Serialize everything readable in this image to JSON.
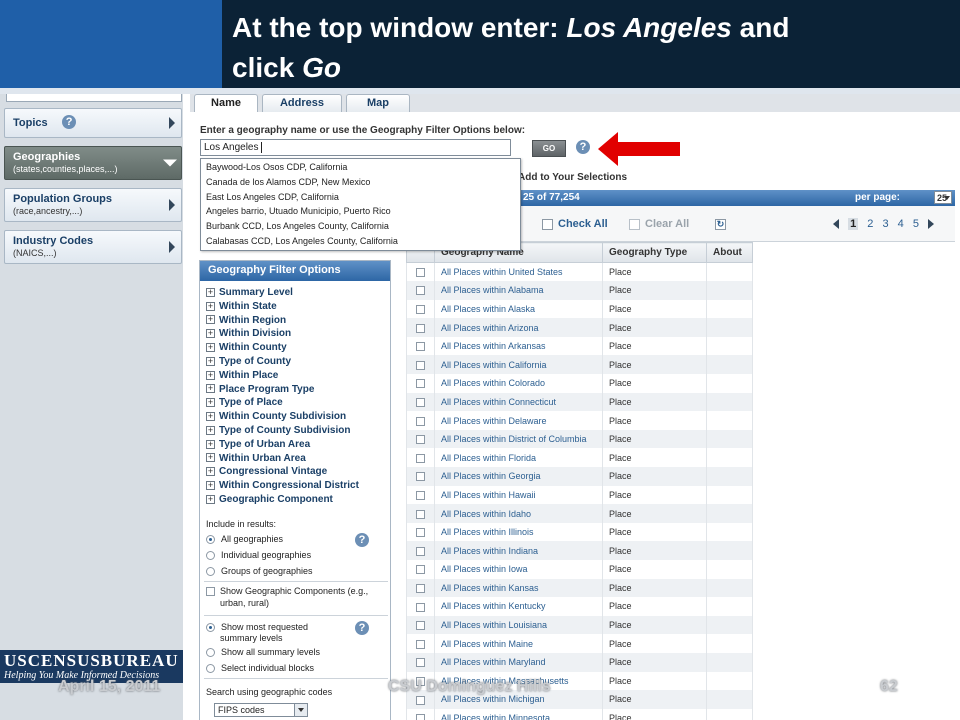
{
  "slide": {
    "title_line1_prefix": "At the top window enter: ",
    "title_line1_italic": "Los Angeles",
    "title_line1_suffix": " and",
    "title_line2_prefix": "click ",
    "title_line2_italic": "Go",
    "colors": {
      "title_bg": "#0b2236",
      "corner_blue": "#1f5fa8",
      "arrow": "#e10000"
    }
  },
  "sidebar": {
    "panels": [
      {
        "title": "Topics",
        "sub": "",
        "active": false,
        "help": "?"
      },
      {
        "title": "Geographies",
        "sub": "(states,counties,places,...)",
        "active": true
      },
      {
        "title": "Population Groups",
        "sub": "(race,ancestry,...)",
        "active": false
      },
      {
        "title": "Industry Codes",
        "sub": "(NAICS,...)",
        "active": false
      }
    ],
    "logo_line1": "USCENSUSBUREAU",
    "logo_line2": "Helping You Make Informed Decisions"
  },
  "tabs": [
    "Name",
    "Address",
    "Map"
  ],
  "search": {
    "label": "Enter a geography name or use the Geography Filter Options below:",
    "value": "Los Angeles",
    "go_label": "GO",
    "help": "?",
    "add_label": "Add to Your Selections",
    "suggestions": [
      "Baywood-Los Osos CDP, California",
      "Canada de los Alamos CDP, New Mexico",
      "East Los Angeles CDP, California",
      "Angeles barrio, Utuado Municipio, Puerto Rico",
      "Burbank CCD, Los Angeles County, California",
      "Calabasas CCD, Los Angeles County, California"
    ]
  },
  "results": {
    "count_text": "25  of  77,254",
    "per_page_label": "per page:",
    "per_page_value": "25",
    "check_all": "Check All",
    "clear_all": "Clear All",
    "pages": [
      "1",
      "2",
      "3",
      "4",
      "5"
    ],
    "columns": [
      "Geography Name",
      "Geography Type",
      "About"
    ],
    "rows": [
      {
        "name": "All Places within United States",
        "type": "Place"
      },
      {
        "name": "All Places within Alabama",
        "type": "Place"
      },
      {
        "name": "All Places within Alaska",
        "type": "Place"
      },
      {
        "name": "All Places within Arizona",
        "type": "Place"
      },
      {
        "name": "All Places within Arkansas",
        "type": "Place"
      },
      {
        "name": "All Places within California",
        "type": "Place"
      },
      {
        "name": "All Places within Colorado",
        "type": "Place"
      },
      {
        "name": "All Places within Connecticut",
        "type": "Place"
      },
      {
        "name": "All Places within Delaware",
        "type": "Place"
      },
      {
        "name": "All Places within District of Columbia",
        "type": "Place"
      },
      {
        "name": "All Places within Florida",
        "type": "Place"
      },
      {
        "name": "All Places within Georgia",
        "type": "Place"
      },
      {
        "name": "All Places within Hawaii",
        "type": "Place"
      },
      {
        "name": "All Places within Idaho",
        "type": "Place"
      },
      {
        "name": "All Places within Illinois",
        "type": "Place"
      },
      {
        "name": "All Places within Indiana",
        "type": "Place"
      },
      {
        "name": "All Places within Iowa",
        "type": "Place"
      },
      {
        "name": "All Places within Kansas",
        "type": "Place"
      },
      {
        "name": "All Places within Kentucky",
        "type": "Place"
      },
      {
        "name": "All Places within Louisiana",
        "type": "Place"
      },
      {
        "name": "All Places within Maine",
        "type": "Place"
      },
      {
        "name": "All Places within Maryland",
        "type": "Place"
      },
      {
        "name": "All Places within Massachusetts",
        "type": "Place"
      },
      {
        "name": "All Places within Michigan",
        "type": "Place"
      },
      {
        "name": "All Places within Minnesota",
        "type": "Place"
      }
    ]
  },
  "filter": {
    "title": "Geography Filter Options",
    "items": [
      "Summary Level",
      "Within State",
      "Within Region",
      "Within Division",
      "Within County",
      "Type of County",
      "Within Place",
      "Place Program Type",
      "Type of Place",
      "Within County Subdivision",
      "Type of County Subdivision",
      "Type of Urban Area",
      "Within Urban Area",
      "Congressional Vintage",
      "Within Congressional District",
      "Geographic Component"
    ],
    "include_label": "Include in results:",
    "include_options": [
      "All geographies",
      "Individual geographies",
      "Groups of geographies"
    ],
    "show_components_l1": "Show Geographic Components (e.g.,",
    "show_components_l2": "urban, rural)",
    "summary_options": [
      "Show most requested",
      "summary levels",
      "Show all summary levels",
      "Select individual blocks"
    ],
    "search_codes_label": "Search using geographic codes",
    "fips_value": "FIPS codes"
  },
  "footer": {
    "date": "April 15, 2011",
    "center": "CSU Dominguez Hills",
    "page": "62"
  }
}
